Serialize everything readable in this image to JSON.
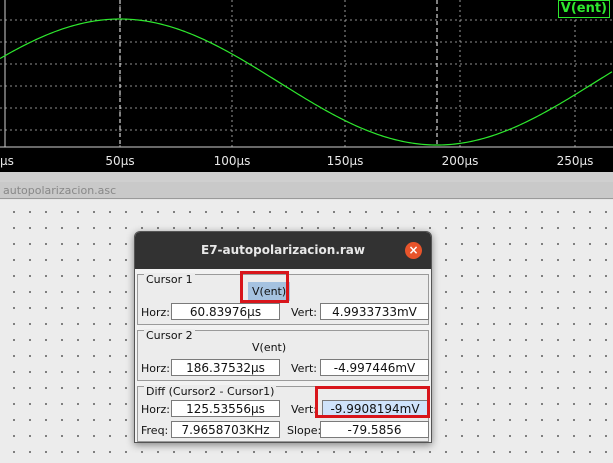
{
  "waveform": {
    "trace_label": "V(ent)",
    "x_ticks": [
      "µs",
      "50µs",
      "100µs",
      "150µs",
      "200µs",
      "250µs"
    ],
    "trace_color": "#2ee82e"
  },
  "schematic": {
    "title": "autopolarizacion.asc"
  },
  "dialog": {
    "title": "E7-autopolarizacion.raw",
    "close_glyph": "×",
    "cursor1": {
      "label": "Cursor 1",
      "trace": "V(ent)",
      "horz_label": "Horz:",
      "horz_value": "60.83976µs",
      "vert_label": "Vert:",
      "vert_value": "4.9933733mV"
    },
    "cursor2": {
      "label": "Cursor 2",
      "trace": "V(ent)",
      "horz_label": "Horz:",
      "horz_value": "186.37532µs",
      "vert_label": "Vert:",
      "vert_value": "-4.997446mV"
    },
    "diff": {
      "label": "Diff (Cursor2 - Cursor1)",
      "horz_label": "Horz:",
      "horz_value": "125.53556µs",
      "vert_label": "Vert:",
      "vert_value": "-9.9908194mV",
      "freq_label": "Freq:",
      "freq_value": "7.9658703KHz",
      "slope_label": "Slope:",
      "slope_value": "-79.5856"
    },
    "highlight_color": "#d8151b"
  }
}
